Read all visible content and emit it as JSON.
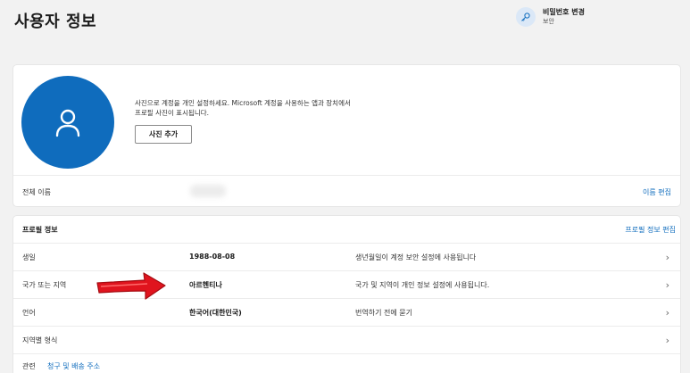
{
  "header": {
    "title": "사용자 정보",
    "password": {
      "title": "비밀번호 변경",
      "subtitle": "보안",
      "icon": "key-icon"
    }
  },
  "photo_card": {
    "avatar_icon": "person-icon",
    "description": "사진으로 계정을 개인 설정하세요. Microsoft 계정을 사용하는 앱과 장치에서 프로필 사진이 표시됩니다.",
    "add_photo_label": "사진 추가",
    "full_name_label": "전체 이름",
    "edit_name_label": "이름 편집"
  },
  "profile": {
    "title": "프로필 정보",
    "edit_label": "프로필 정보 편집",
    "rows": [
      {
        "label": "생일",
        "value": "1988-08-08",
        "desc": "생년월일이 계정 보안 설정에 사용됩니다"
      },
      {
        "label": "국가 또는 지역",
        "value": "아르헨티나",
        "desc": "국가 및 지역이 개인 정보 설정에 사용됩니다."
      },
      {
        "label": "언어",
        "value": "한국어(대한민국)",
        "desc": "번역하기 전에 묻기"
      },
      {
        "label": "지역별 형식",
        "value": "",
        "desc": ""
      }
    ],
    "chevron": "›"
  },
  "related": {
    "label": "관련",
    "link": "청구 및 배송 주소"
  },
  "colors": {
    "accent": "#0f6cbd",
    "arrow": "#e0141e"
  }
}
